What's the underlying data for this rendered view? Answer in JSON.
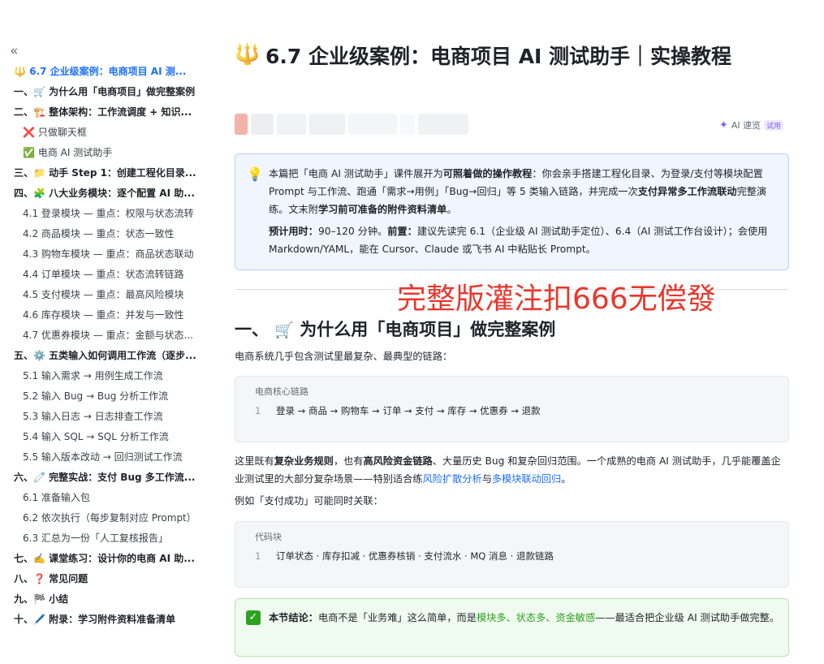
{
  "sidebar": {
    "collapse_glyph": "«",
    "items": [
      {
        "level": 1,
        "active": true,
        "emoji": "🔱",
        "text": "6.7 企业级案例：电商项目 AI 测..."
      },
      {
        "level": 1,
        "emoji": "",
        "text": "一、🛒 为什么用「电商项目」做完整案例"
      },
      {
        "level": 1,
        "emoji": "",
        "text": "二、🏗️ 整体架构：工作流调度 + 知识..."
      },
      {
        "level": 2,
        "emoji": "❌",
        "text": "只做聊天框"
      },
      {
        "level": 2,
        "emoji": "✅",
        "text": "电商 AI 测试助手"
      },
      {
        "level": 1,
        "emoji": "",
        "text": "三、📁 动手 Step 1：创建工程化目录..."
      },
      {
        "level": 1,
        "emoji": "",
        "text": "四、🧩 八大业务模块：逐个配置 AI 助..."
      },
      {
        "level": 2,
        "emoji": "",
        "text": "4.1 登录模块 — 重点：权限与状态流转"
      },
      {
        "level": 2,
        "emoji": "",
        "text": "4.2 商品模块 — 重点：状态一致性"
      },
      {
        "level": 2,
        "emoji": "",
        "text": "4.3 购物车模块 — 重点：商品状态联动"
      },
      {
        "level": 2,
        "emoji": "",
        "text": "4.4 订单模块 — 重点：状态流转链路"
      },
      {
        "level": 2,
        "emoji": "",
        "text": "4.5 支付模块 — 重点：最高风险模块"
      },
      {
        "level": 2,
        "emoji": "",
        "text": "4.6 库存模块 — 重点：并发与一致性"
      },
      {
        "level": 2,
        "emoji": "",
        "text": "4.7 优惠券模块 — 重点：金额与状态..."
      },
      {
        "level": 1,
        "emoji": "",
        "text": "五、⚙️ 五类输入如何调用工作流（逐步..."
      },
      {
        "level": 2,
        "emoji": "",
        "text": "5.1 输入需求 → 用例生成工作流"
      },
      {
        "level": 2,
        "emoji": "",
        "text": "5.2 输入 Bug → Bug 分析工作流"
      },
      {
        "level": 2,
        "emoji": "",
        "text": "5.3 输入日志 → 日志排查工作流"
      },
      {
        "level": 2,
        "emoji": "",
        "text": "5.4 输入 SQL → SQL 分析工作流"
      },
      {
        "level": 2,
        "emoji": "",
        "text": "5.5 输入版本改动 → 回归测试工作流"
      },
      {
        "level": 1,
        "emoji": "",
        "text": "六、🧷 完整实战：支付 Bug 多工作流..."
      },
      {
        "level": 2,
        "emoji": "",
        "text": "6.1 准备输入包"
      },
      {
        "level": 2,
        "emoji": "",
        "text": "6.2 依次执行（每步复制对应 Prompt）"
      },
      {
        "level": 2,
        "emoji": "",
        "text": "6.3 汇总为一份「人工复核报告」"
      },
      {
        "level": 1,
        "emoji": "",
        "text": "七、✍️ 课堂练习：设计你的电商 AI 助..."
      },
      {
        "level": 1,
        "emoji": "",
        "text": "八、❓ 常见问题"
      },
      {
        "level": 1,
        "emoji": "",
        "text": "九、🏁 小结"
      },
      {
        "level": 1,
        "emoji": "",
        "text": "十、🖊️ 附录：学习附件资料准备清单"
      }
    ]
  },
  "doc": {
    "title_icon": "🔱",
    "title": "6.7 企业级案例：电商项目 AI 测试助手｜实操教程",
    "ai_quick": {
      "label": "AI 速览",
      "badge": "试用"
    },
    "intro": {
      "p1_a": "本篇把「电商 AI 测试助手」课件展开为",
      "p1_b": "可照着做的操作教程",
      "p1_c": "：你会亲手搭建工程化目录、为登录/支付等模块配置 Prompt 与工作流、跑通「需求→用例」「Bug→回归」等 5 类输入链路，并完成一次",
      "p1_d": "支付异常多工作流联动",
      "p1_e": "完整演练。文末附",
      "p1_f": "学习前可准备的附件资料清单",
      "p1_g": "。",
      "p2_a": "预计用时：",
      "p2_b": "90–120 分钟。",
      "p2_c": "前置：",
      "p2_d": "建议先读完 6.1（企业级 AI 测试助手定位）、6.4（AI 测试工作台设计）；会使用 Markdown/YAML，能在 Cursor、Claude 或飞书 AI 中粘贴长 Prompt。"
    },
    "watermark": "完整版灌注扣666无偿發",
    "section1": {
      "heading_prefix": "一、",
      "heading_icon": "🛒",
      "heading": "为什么用「电商项目」做完整案例",
      "lead": "电商系统几乎包含测试里最复杂、最典型的链路：",
      "code1": {
        "caption": "电商核心链路",
        "line_no": "1",
        "code": "登录 → 商品 → 购物车 → 订单 → 支付 → 库存 → 优惠券 → 退款"
      },
      "para2_a": "这里既有",
      "para2_b": "复杂业务规则",
      "para2_c": "，也有",
      "para2_d": "高风险资金链路",
      "para2_e": "、大量历史 Bug 和复杂回归范围。一个成熟的电商 AI 测试助手，几乎能覆盖企业测试里的大部分复杂场景——特别适合练",
      "para2_f": "风险扩散分析",
      "para2_g": "与",
      "para2_h": "多模块联动回归",
      "para2_i": "。",
      "para3": "例如「支付成功」可能同时关联：",
      "code2": {
        "caption": "代码块",
        "line_no": "1",
        "code": "订单状态 · 库存扣减 · 优惠券核销 · 支付流水 · MQ 消息 · 退款链路"
      },
      "conclusion": {
        "a": "本节结论：",
        "b": "电商不是「业务难」这么简单，而是",
        "c": "模块多、状态多、资金敏感",
        "d": "——最适合把企业级 AI 测试助手做完整。"
      }
    }
  }
}
